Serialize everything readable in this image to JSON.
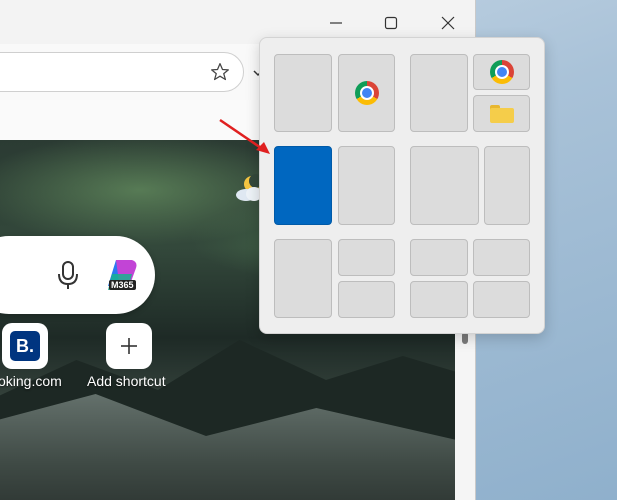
{
  "browser": {
    "titlebar": {
      "minimize_icon": "minimize-icon",
      "maximize_icon": "maximize-icon",
      "close_icon": "close-icon"
    },
    "address_bar": {
      "favorite_icon": "star-icon"
    },
    "new_tab_page": {
      "search": {
        "mic_icon": "microphone-icon",
        "copilot_badge": "M365"
      },
      "weather_icon": "moon-cloud-icon",
      "shortcuts": [
        {
          "label": "oking.com",
          "icon_text": "B.",
          "icon": "booking-icon"
        },
        {
          "label": "Add shortcut",
          "icon": "plus-icon"
        }
      ]
    }
  },
  "snap_layouts": {
    "active_zone": "layout-2-zone-1",
    "accent_color": "#0067c0",
    "annotation_arrow_color": "#e02020",
    "zone_icons": {
      "chrome": "chrome-icon",
      "file_explorer": "folder-icon"
    }
  }
}
